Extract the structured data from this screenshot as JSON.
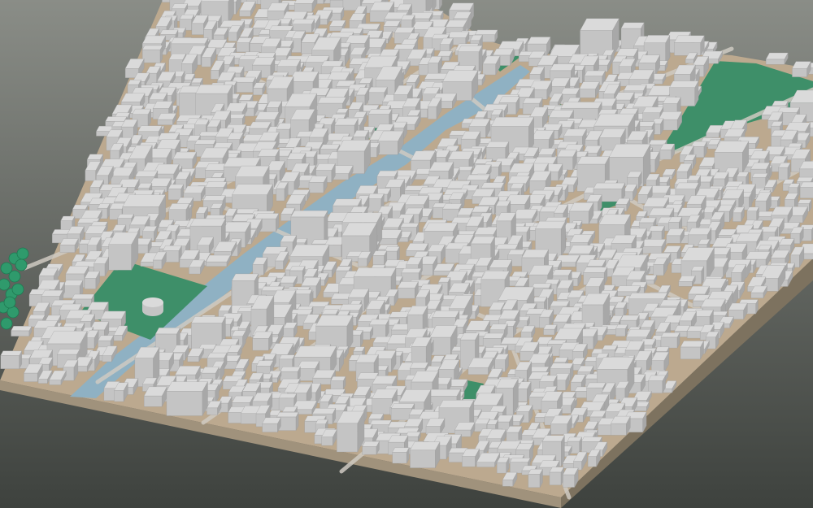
{
  "scene": {
    "kind": "3d-city-block-model",
    "view": "oblique-aerial",
    "seed": 7
  },
  "colors": {
    "background_top": "#8a8d87",
    "background_bottom": "#3e423e",
    "terrain": "#bca98f",
    "terrain_side_front": "#a0927c",
    "terrain_side_right": "#7d725f",
    "river": "#8fb1c3",
    "green_area": "#3e8f69",
    "building_top": "#dadada",
    "building_side_light": "#c4c4c4",
    "building_side_dark": "#a8a8a8",
    "road": "#cfcac2",
    "tree": "#2f9a6c"
  },
  "icons": {
    "trees": "tree-cluster-icon",
    "round_building": "round-tower-icon"
  }
}
